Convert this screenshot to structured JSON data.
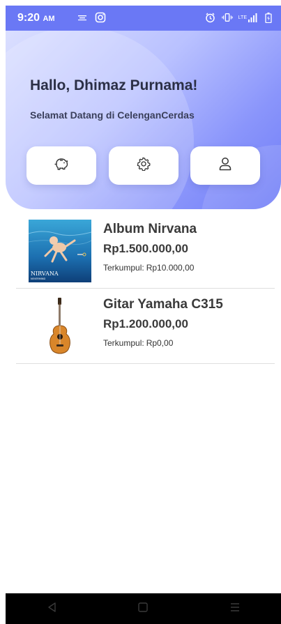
{
  "status_bar": {
    "time": "9:20",
    "ampm": "AM",
    "network_label": "LTE"
  },
  "header": {
    "greeting": "Hallo, Dhimaz Purnama!",
    "subtitle": "Selamat Datang di CelenganCerdas"
  },
  "actions": [
    {
      "icon": "piggy-bank-icon"
    },
    {
      "icon": "gear-icon"
    },
    {
      "icon": "user-icon"
    }
  ],
  "items": [
    {
      "title": "Album Nirvana",
      "price": "Rp1.500.000,00",
      "collected_label": "Terkumpul:",
      "collected_value": "Rp10.000,00",
      "cover_text": "NIRVANA",
      "cover_subtext": "NEVERMIND"
    },
    {
      "title": "Gitar Yamaha C315",
      "price": "Rp1.200.000,00",
      "collected_label": "Terkumpul:",
      "collected_value": "Rp0,00"
    }
  ],
  "colors": {
    "accent": "#6f7cf7",
    "status_bar": "#6a78f5",
    "nav_bar": "#000000"
  },
  "nav": [
    {
      "icon": "back-icon"
    },
    {
      "icon": "home-icon"
    },
    {
      "icon": "menu-icon"
    }
  ]
}
